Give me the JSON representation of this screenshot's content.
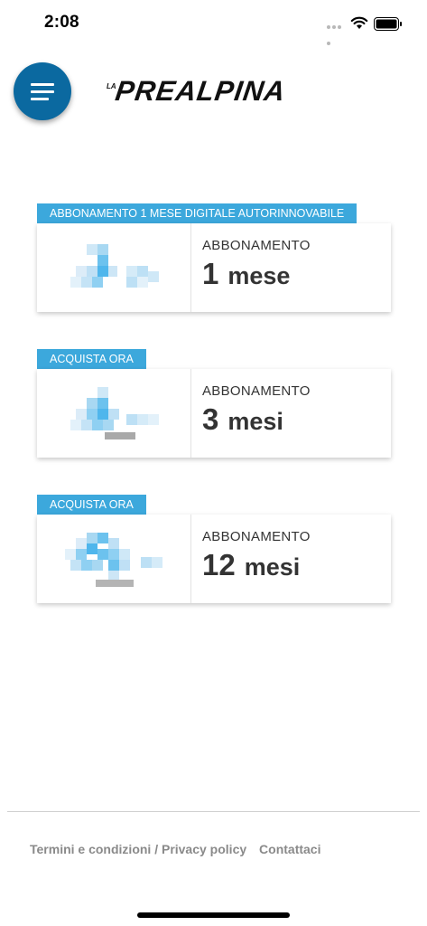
{
  "status_bar": {
    "time": "2:08"
  },
  "header": {
    "logo_prefix": "LA",
    "logo_name": "PREALPINA"
  },
  "offers": [
    {
      "tag": "ABBONAMENTO 1 MESE DIGITALE AUTORINNOVABILE",
      "label": "ABBONAMENTO",
      "number": "1",
      "unit": "mese"
    },
    {
      "tag": "ACQUISTA ORA",
      "label": "ABBONAMENTO",
      "number": "3",
      "unit": "mesi"
    },
    {
      "tag": "ACQUISTA ORA",
      "label": "ABBONAMENTO",
      "number": "12",
      "unit": "mesi"
    }
  ],
  "footer": {
    "terms_link": "Termini e condizioni / Privacy policy",
    "contact_link": "Contattaci"
  },
  "colors": {
    "accent": "#3ca8dc",
    "menu_button": "#0b69a0",
    "footer_text": "#8a8a8a"
  },
  "icons": [
    "wifi-icon",
    "battery-icon",
    "hamburger-menu-icon"
  ]
}
